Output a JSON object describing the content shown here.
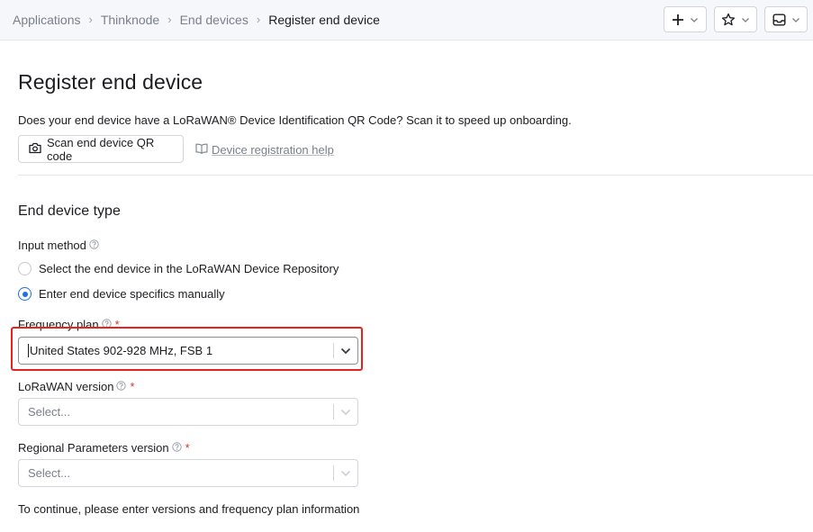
{
  "breadcrumb": {
    "items": [
      "Applications",
      "Thinknode",
      "End devices"
    ],
    "current": "Register end device",
    "separator": "›"
  },
  "header_actions": [
    {
      "icon": "plus-icon"
    },
    {
      "icon": "star-icon"
    },
    {
      "icon": "inbox-icon"
    }
  ],
  "page": {
    "title": "Register end device",
    "qr_prompt": "Does your end device have a LoRaWAN® Device Identification QR Code? Scan it to speed up onboarding.",
    "scan_button": "Scan end device QR code",
    "help_link": "Device registration help"
  },
  "end_device_type": {
    "section_title": "End device type",
    "input_method_label": "Input method",
    "options": [
      {
        "label": "Select the end device in the LoRaWAN Device Repository",
        "checked": false
      },
      {
        "label": "Enter end device specifics manually",
        "checked": true
      }
    ],
    "frequency_plan": {
      "label": "Frequency plan",
      "required_mark": "*",
      "value": "United States 902-928 MHz, FSB 1"
    },
    "lorawan_version": {
      "label": "LoRaWAN version",
      "required_mark": "*",
      "placeholder": "Select..."
    },
    "regional_parameters_version": {
      "label": "Regional Parameters version",
      "required_mark": "*",
      "placeholder": "Select..."
    },
    "hint": "To continue, please enter versions and frequency plan information"
  },
  "colors": {
    "accent": "#1f6fe5",
    "highlight": "#e8231d",
    "required": "#d93025"
  }
}
